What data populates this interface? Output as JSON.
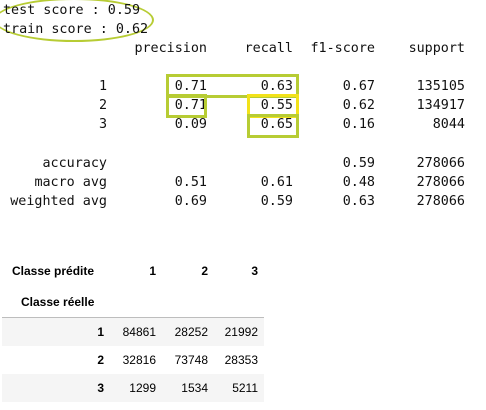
{
  "scores": {
    "test": "test score : 0.59",
    "train": "train score : 0.62"
  },
  "report": {
    "headers": [
      "precision",
      "recall",
      "f1-score",
      "support"
    ],
    "class_rows": [
      {
        "label": "1",
        "precision": "0.71",
        "recall": "0.63",
        "f1": "0.67",
        "support": "135105"
      },
      {
        "label": "2",
        "precision": "0.71",
        "recall": "0.55",
        "f1": "0.62",
        "support": "134917"
      },
      {
        "label": "3",
        "precision": "0.09",
        "recall": "0.65",
        "f1": "0.16",
        "support": "8044"
      }
    ],
    "summary_rows": [
      {
        "label": "accuracy",
        "precision": "",
        "recall": "",
        "f1": "0.59",
        "support": "278066"
      },
      {
        "label": "macro avg",
        "precision": "0.51",
        "recall": "0.61",
        "f1": "0.48",
        "support": "278066"
      },
      {
        "label": "weighted avg",
        "precision": "0.69",
        "recall": "0.59",
        "f1": "0.63",
        "support": "278066"
      }
    ]
  },
  "confusion": {
    "predicted_label": "Classe prédite",
    "actual_label": "Classe réelle",
    "columns": [
      "1",
      "2",
      "3"
    ],
    "rows": [
      {
        "index": "1",
        "values": [
          "84861",
          "28252",
          "21992"
        ]
      },
      {
        "index": "2",
        "values": [
          "32816",
          "73748",
          "28353"
        ]
      },
      {
        "index": "3",
        "values": [
          "1299",
          "1534",
          "5211"
        ]
      }
    ]
  },
  "highlight_colors": {
    "lime": "#b7cc34",
    "yellow": "#f2e21a"
  }
}
